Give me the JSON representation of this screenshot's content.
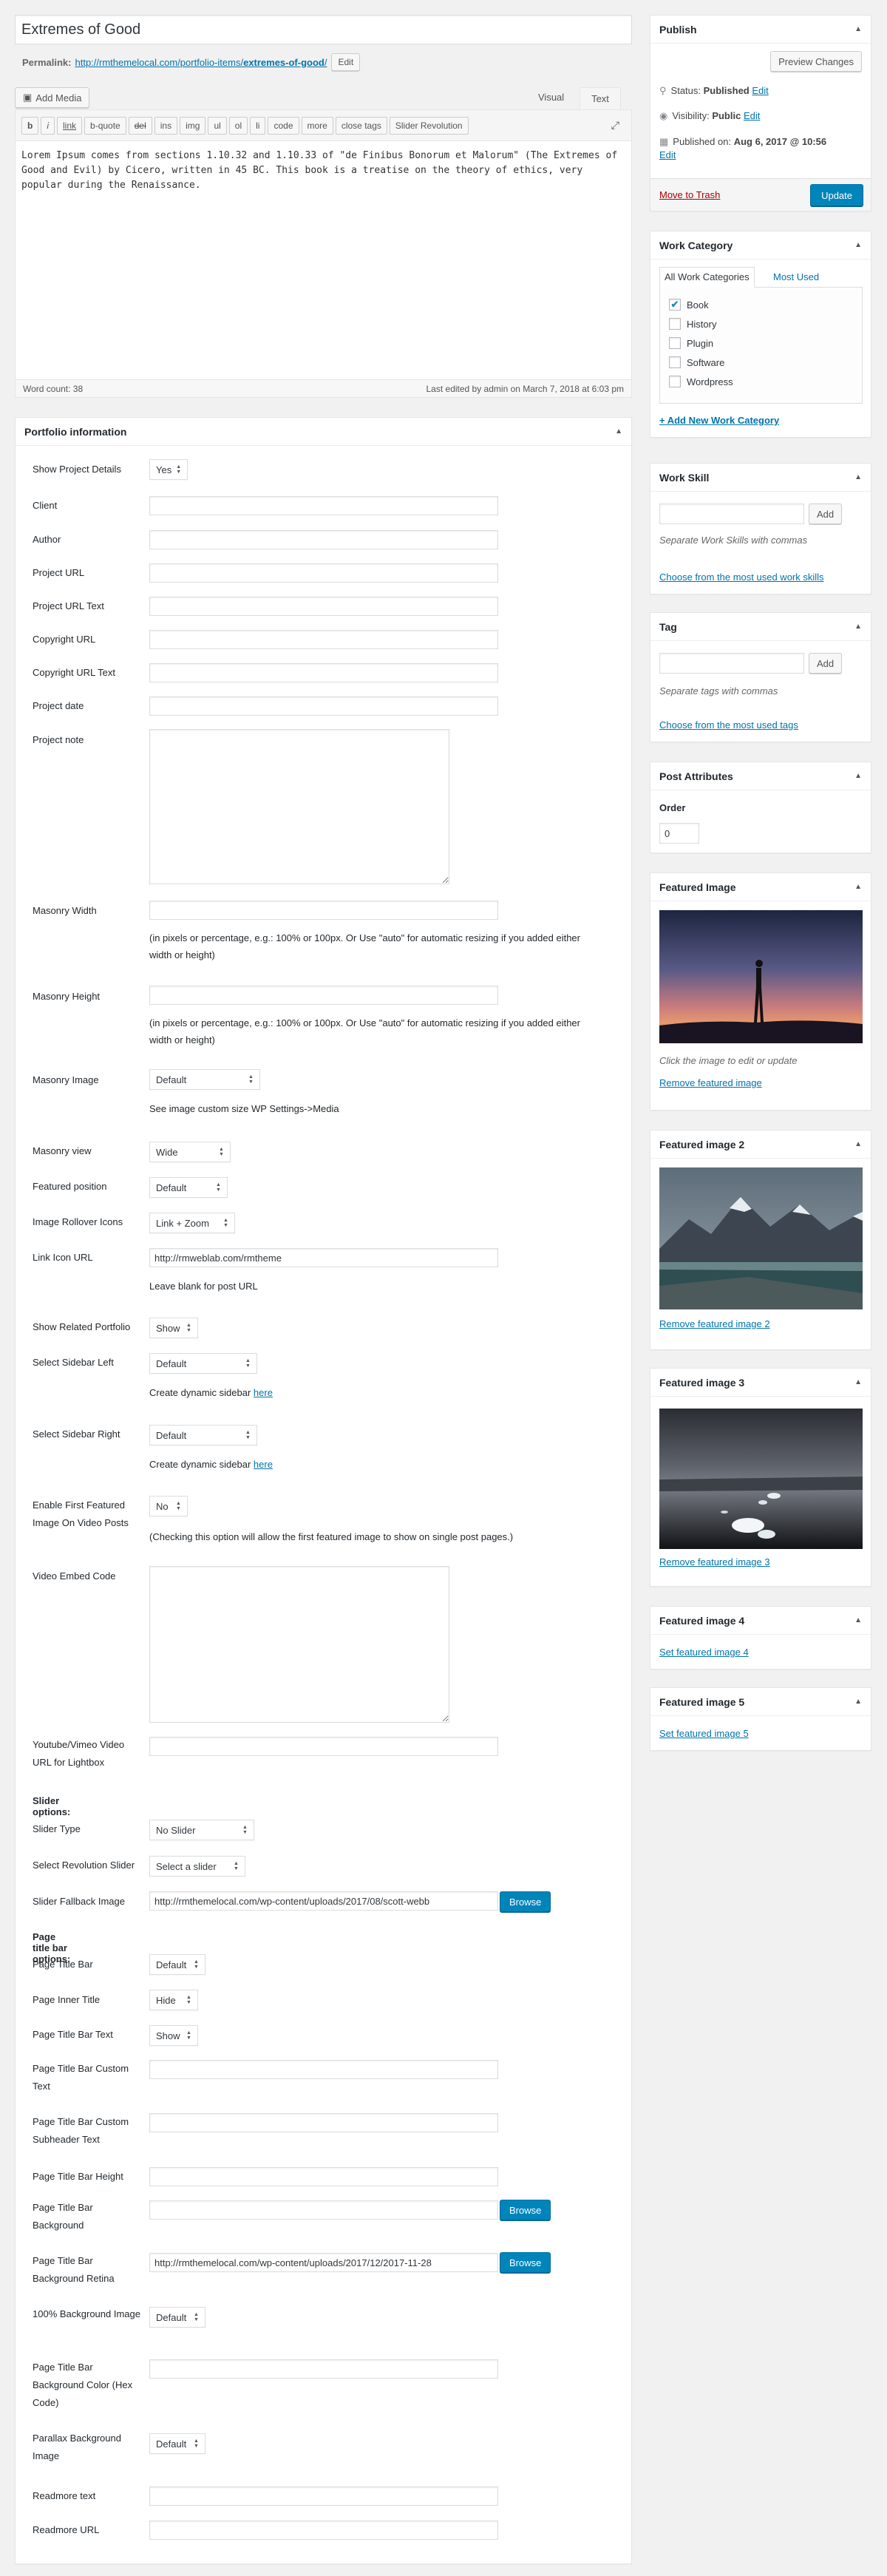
{
  "post": {
    "title": "Extremes of Good",
    "permalink_label": "Permalink:",
    "permalink_base": "http://rmthemelocal.com/portfolio-items/",
    "permalink_slug": "extremes-of-good",
    "permalink_end": "/",
    "edit_label": "Edit"
  },
  "editor": {
    "add_media": "Add Media",
    "tab_visual": "Visual",
    "tab_text": "Text",
    "tags": [
      "b",
      "i",
      "link",
      "b-quote",
      "del",
      "ins",
      "img",
      "ul",
      "ol",
      "li",
      "code",
      "more",
      "close tags",
      "Slider Revolution"
    ],
    "content": "Lorem Ipsum comes from sections 1.10.32 and 1.10.33 of \"de Finibus Bonorum et Malorum\" (The Extremes of Good and Evil) by Cicero, written in 45 BC. This book is a treatise on the theory of ethics, very popular during the Renaissance.",
    "word_count": "Word count: 38",
    "last_edited": "Last edited by admin on March 7, 2018 at 6:03 pm"
  },
  "portfolio": {
    "title": "Portfolio information",
    "show_project_details": {
      "label": "Show Project Details",
      "value": "Yes"
    },
    "client": "Client",
    "author": "Author",
    "project_url": "Project URL",
    "project_url_text": "Project URL Text",
    "copyright_url": "Copyright URL",
    "copyright_url_text": "Copyright URL Text",
    "project_date": "Project date",
    "project_note": "Project note",
    "masonry_width": "Masonry Width",
    "masonry_width_note": "(in pixels or percentage, e.g.: 100% or 100px. Or Use \"auto\" for automatic resizing if you added either width or height)",
    "masonry_height": "Masonry Height",
    "masonry_height_note": "(in pixels or percentage, e.g.: 100% or 100px. Or Use \"auto\" for automatic resizing if you added either width or height)",
    "masonry_image": {
      "label": "Masonry Image",
      "value": "Default",
      "note": "See image custom size WP Settings->Media"
    },
    "masonry_view": {
      "label": "Masonry view",
      "value": "Wide"
    },
    "featured_position": {
      "label": "Featured position",
      "value": "Default"
    },
    "image_rollover": {
      "label": "Image Rollover Icons",
      "value": "Link + Zoom"
    },
    "link_icon_url": {
      "label": "Link Icon URL",
      "value": "http://rmweblab.com/rmtheme",
      "note": "Leave blank for post URL"
    },
    "show_related": {
      "label": "Show Related Portfolio",
      "value": "Show"
    },
    "sidebar_left": {
      "label": "Select Sidebar Left",
      "value": "Default",
      "note": "Create dynamic sidebar",
      "link": "here"
    },
    "sidebar_right": {
      "label": "Select Sidebar Right",
      "value": "Default",
      "note": "Create dynamic sidebar",
      "link": "here"
    },
    "enable_first_featured": {
      "label": "Enable First Featured Image On Video Posts",
      "value": "No",
      "note": "(Checking this option will allow the first featured image to show on single post pages.)"
    },
    "video_embed": "Video Embed Code",
    "youtube": "Youtube/Vimeo Video URL for Lightbox",
    "slider_options": "Slider options:",
    "slider_type": {
      "label": "Slider Type",
      "value": "No Slider"
    },
    "rev_slider": {
      "label": "Select Revolution Slider",
      "value": "Select a slider"
    },
    "slider_fallback": {
      "label": "Slider Fallback Image",
      "value": "http://rmthemelocal.com/wp-content/uploads/2017/08/scott-webb"
    },
    "browse": "Browse",
    "page_title_options": "Page title bar options:",
    "ptb": {
      "label": "Page Title Bar",
      "value": "Default"
    },
    "pit": {
      "label": "Page Inner Title",
      "value": "Hide"
    },
    "ptbt": {
      "label": "Page Title Bar Text",
      "value": "Show"
    },
    "ptbct": "Page Title Bar Custom Text",
    "ptbcs": "Page Title Bar Custom Subheader Text",
    "ptbh": "Page Title Bar Height",
    "ptbbg": "Page Title Bar Background",
    "ptbbgr": {
      "label": "Page Title Bar Background Retina",
      "value": "http://rmthemelocal.com/wp-content/uploads/2017/12/2017-11-28"
    },
    "bg100": {
      "label": "100% Background Image",
      "value": "Default"
    },
    "ptbcolor": "Page Title Bar Background Color (Hex Code)",
    "parallax": {
      "label": "Parallax Background Image",
      "value": "Default"
    },
    "readmore_text": "Readmore text",
    "readmore_url": "Readmore URL"
  },
  "publish": {
    "title": "Publish",
    "preview": "Preview Changes",
    "status_label": "Status:",
    "status": "Published",
    "visibility_label": "Visibility:",
    "visibility": "Public",
    "published_label": "Published on:",
    "published": "Aug 6, 2017 @ 10:56",
    "edit": "Edit",
    "trash": "Move to Trash",
    "update": "Update"
  },
  "work_category": {
    "title": "Work Category",
    "tab_all": "All Work Categories",
    "tab_used": "Most Used",
    "items": [
      {
        "label": "Book",
        "checked": "✔"
      },
      {
        "label": "History",
        "checked": ""
      },
      {
        "label": "Plugin",
        "checked": ""
      },
      {
        "label": "Software",
        "checked": ""
      },
      {
        "label": "Wordpress",
        "checked": ""
      }
    ],
    "add_new": "+ Add New Work Category"
  },
  "work_skill": {
    "title": "Work Skill",
    "add": "Add",
    "help": "Separate Work Skills with commas",
    "choose": "Choose from the most used work skills"
  },
  "tag": {
    "title": "Tag",
    "add": "Add",
    "help": "Separate tags with commas",
    "choose": "Choose from the most used tags"
  },
  "post_attributes": {
    "title": "Post Attributes",
    "order_label": "Order",
    "order_value": "0"
  },
  "featured_image": {
    "title": "Featured Image",
    "help": "Click the image to edit or update",
    "remove": "Remove featured image"
  },
  "featured_image_2": {
    "title": "Featured image 2",
    "remove": "Remove featured image 2"
  },
  "featured_image_3": {
    "title": "Featured image 3",
    "remove": "Remove featured image 3"
  },
  "featured_image_4": {
    "title": "Featured image 4",
    "set": "Set featured image 4"
  },
  "featured_image_5": {
    "title": "Featured image 5",
    "set": "Set featured image 5"
  },
  "colors": {
    "accent": "#0073aa",
    "button": "#0085ba",
    "trash": "#a00"
  }
}
